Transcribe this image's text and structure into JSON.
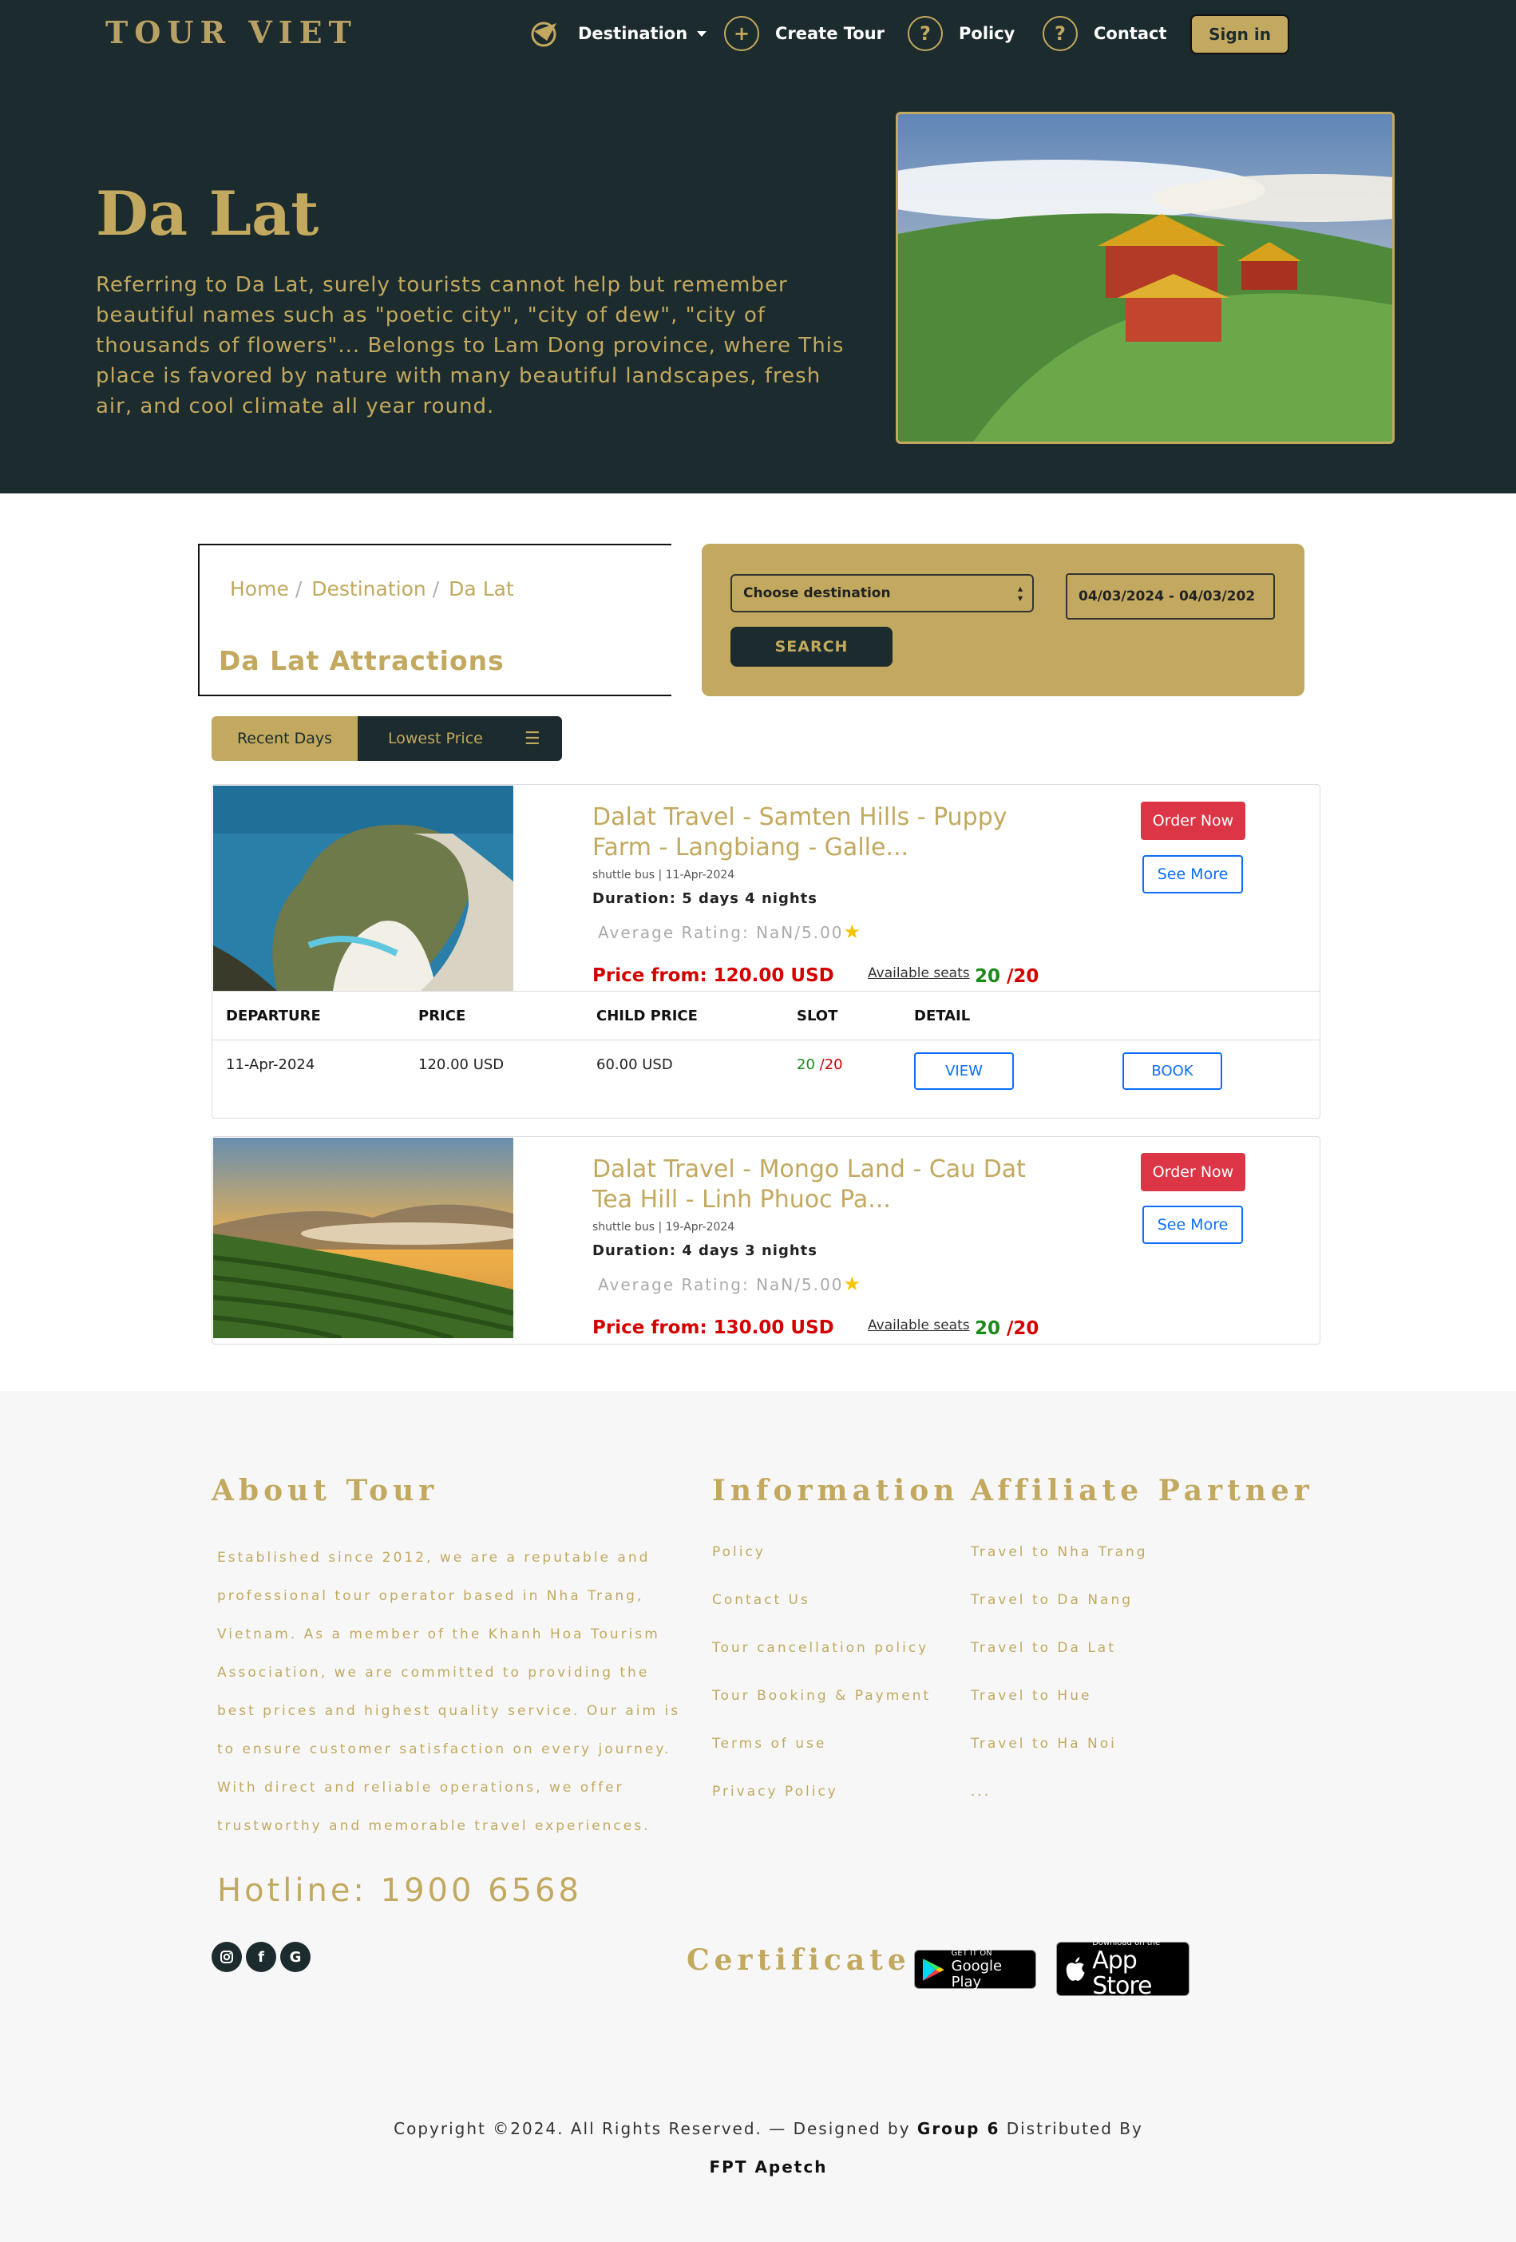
{
  "nav": {
    "logo": "TOUR VIET",
    "destination": "Destination",
    "create_tour": "Create Tour",
    "policy": "Policy",
    "contact": "Contact",
    "sign_in": "Sign in",
    "icon_plus": "+",
    "icon_question": "?"
  },
  "hero": {
    "title": "Da Lat",
    "description": "Referring to Da Lat, surely tourists cannot help but remember beautiful names such as \"poetic city\", \"city of dew\", \"city of thousands of flowers\"... Belongs to Lam Dong province, where This place is favored by nature with many beautiful landscapes, fresh air, and cool climate all year round."
  },
  "breadcrumb": {
    "home": "Home",
    "destination": "Destination",
    "current": "Da Lat",
    "separator": "/"
  },
  "attractions_title": "Da Lat Attractions",
  "search": {
    "destination_select": "Choose destination",
    "date_range": "04/03/2024 - 04/03/202",
    "button": "SEARCH"
  },
  "sort": {
    "recent": "Recent Days",
    "lowest_price": "Lowest Price",
    "menu_icon": "☰"
  },
  "tours": [
    {
      "title": "Dalat Travel - Samten Hills - Puppy Farm - Langbiang - Galle...",
      "meta": "shuttle bus | 11-Apr-2024",
      "duration": "Duration: 5 days 4 nights",
      "rating": "Average Rating: NaN/5.00",
      "price": "Price from: 120.00 USD",
      "seats_label": "Available seats",
      "seats_available": "20",
      "seats_total": "/20",
      "order_label": "Order Now",
      "more_label": "See More"
    },
    {
      "title": "Dalat Travel - Mongo Land - Cau Dat Tea Hill - Linh Phuoc Pa...",
      "meta": "shuttle bus | 19-Apr-2024",
      "duration": "Duration: 4 days 3 nights",
      "rating": "Average Rating: NaN/5.00",
      "price": "Price from: 130.00 USD",
      "seats_label": "Available seats",
      "seats_available": "20",
      "seats_total": "/20",
      "order_label": "Order Now",
      "more_label": "See More"
    }
  ],
  "departures": {
    "headers": [
      "DEPARTURE",
      "PRICE",
      "CHILD PRICE",
      "SLOT",
      "DETAIL"
    ],
    "rows": [
      {
        "departure": "11-Apr-2024",
        "price": "120.00 USD",
        "child_price": "60.00 USD",
        "slot_available": "20",
        "slot_total": "/20",
        "view": "VIEW",
        "book": "BOOK"
      }
    ]
  },
  "footer": {
    "about_title": "About Tour",
    "about_text": "Established since 2012, we are a reputable and professional tour operator based in Nha Trang, Vietnam. As a member of the Khanh Hoa Tourism Association, we are committed to providing the best prices and highest quality service. Our aim is to ensure customer satisfaction on every journey. With direct and reliable operations, we offer trustworthy and memorable travel experiences.",
    "hotline": "Hotline: 1900 6568",
    "info_title": "Information",
    "info_links": [
      "Policy",
      "Contact Us",
      "Tour cancellation policy",
      "Tour Booking & Payment",
      "Terms of use",
      "Privacy Policy"
    ],
    "partner_title": "Affiliate Partner",
    "partner_links": [
      "Travel to Nha Trang",
      "Travel to Da Nang",
      "Travel to Da Lat",
      "Travel to Hue",
      "Travel to Ha Noi",
      "..."
    ],
    "certificate": "Certificate",
    "google_play_small": "GET IT ON",
    "google_play": "Google Play",
    "app_store_small": "Download on the",
    "app_store": "App Store",
    "social_icons": [
      "instagram-icon",
      "facebook-icon",
      "google-icon"
    ],
    "copyright_prefix": "Copyright ©2024. All Rights Reserved. — Designed by",
    "designer": "Group 6",
    "distributed": "Distributed By",
    "distributor": "FPT Apetch"
  },
  "colors": {
    "dark": "#1c2b2d",
    "gold": "#c2a95f",
    "red": "#dc3545",
    "blue": "#0d6efd"
  }
}
